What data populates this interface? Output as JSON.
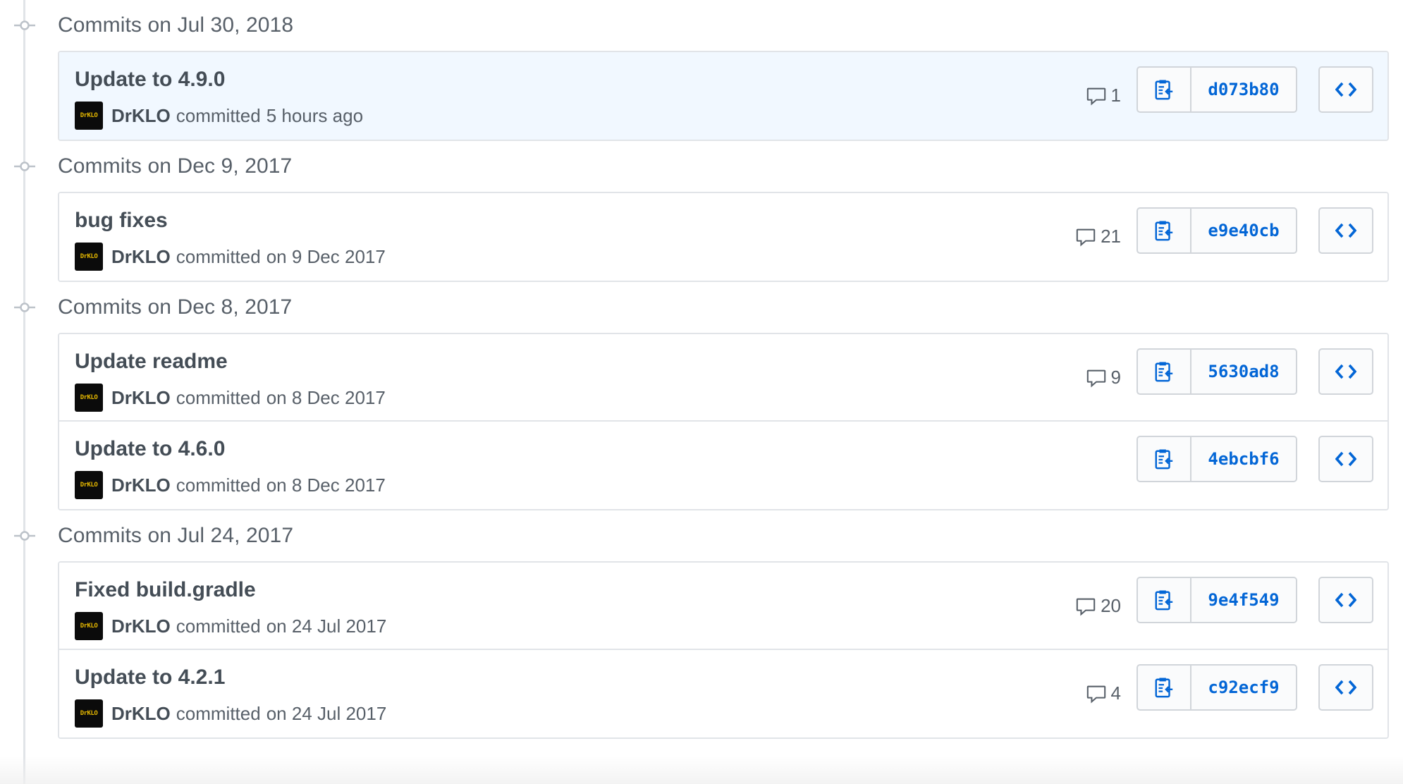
{
  "groups": [
    {
      "title": "Commits on Jul 30, 2018",
      "commits": [
        {
          "title": "Update to 4.9.0",
          "author": "DrKLO",
          "verb": "committed",
          "when": "5 hours ago",
          "comments": "1",
          "sha": "d073b80",
          "highlight": true
        }
      ]
    },
    {
      "title": "Commits on Dec 9, 2017",
      "commits": [
        {
          "title": "bug fixes",
          "author": "DrKLO",
          "verb": "committed",
          "when": "on 9 Dec 2017",
          "comments": "21",
          "sha": "e9e40cb",
          "highlight": false
        }
      ]
    },
    {
      "title": "Commits on Dec 8, 2017",
      "commits": [
        {
          "title": "Update readme",
          "author": "DrKLO",
          "verb": "committed",
          "when": "on 8 Dec 2017",
          "comments": "9",
          "sha": "5630ad8",
          "highlight": false
        },
        {
          "title": "Update to 4.6.0",
          "author": "DrKLO",
          "verb": "committed",
          "when": "on 8 Dec 2017",
          "comments": "",
          "sha": "4ebcbf6",
          "highlight": false
        }
      ]
    },
    {
      "title": "Commits on Jul 24, 2017",
      "commits": [
        {
          "title": "Fixed build.gradle",
          "author": "DrKLO",
          "verb": "committed",
          "when": "on 24 Jul 2017",
          "comments": "20",
          "sha": "9e4f549",
          "highlight": false
        },
        {
          "title": "Update to 4.2.1",
          "author": "DrKLO",
          "verb": "committed",
          "when": "on 24 Jul 2017",
          "comments": "4",
          "sha": "c92ecf9",
          "highlight": false
        }
      ]
    }
  ],
  "avatar_text": "DrKLO",
  "icons": {
    "commit": "git-commit-icon",
    "comment": "comment-icon",
    "copy": "clipboard-icon",
    "browse": "code-icon"
  },
  "colors": {
    "link": "#0366d6",
    "highlight_bg": "#f1f8ff",
    "border": "#e1e4e8"
  }
}
